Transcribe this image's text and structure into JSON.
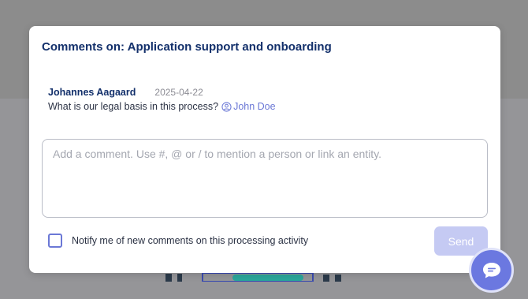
{
  "modal": {
    "title": "Comments on: Application support and onboarding"
  },
  "comment": {
    "author": "Johannes Aagaard",
    "date": "2025-04-22",
    "text": "What is our legal basis in this process?",
    "mention": "John Doe",
    "mention_icon": "user-circle-icon"
  },
  "input": {
    "placeholder": "Add a comment. Use #, @ or / to mention a person or link an entity.",
    "value": ""
  },
  "notify": {
    "label": "Notify me of new comments on this processing activity",
    "checked": false
  },
  "send_label": "Send",
  "chat_icon": "chat-bubble-icon",
  "colors": {
    "title": "#13306b",
    "accent": "#6b78d6",
    "send_disabled": "#c5caf3",
    "fab": "#6b78e0"
  }
}
